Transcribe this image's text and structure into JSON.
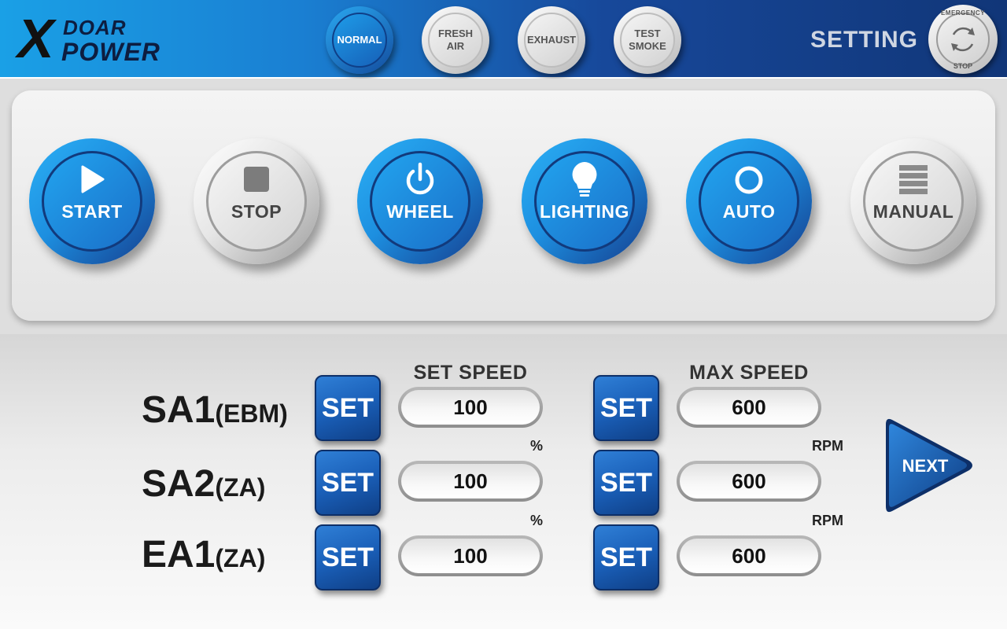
{
  "brand": {
    "line1": "DOAR",
    "line2": "POWER",
    "mark": "X"
  },
  "modes": [
    {
      "label": "NORMAL",
      "active": true
    },
    {
      "label": "FRESH AIR",
      "active": false
    },
    {
      "label": "EXHAUST",
      "active": false
    },
    {
      "label": "TEST SMOKE",
      "active": false
    }
  ],
  "header": {
    "setting_label": "SETTING"
  },
  "estop": {
    "top_text": "EMERGENCY",
    "bottom_text": "STOP",
    "icon": "rotate-icon"
  },
  "controls": [
    {
      "label": "START",
      "icon": "play-icon",
      "active": true
    },
    {
      "label": "STOP",
      "icon": "stop-square-icon",
      "active": false
    },
    {
      "label": "WHEEL",
      "icon": "power-icon",
      "active": true
    },
    {
      "label": "LIGHTING",
      "icon": "bulb-icon",
      "active": true
    },
    {
      "label": "AUTO",
      "icon": "circle-icon",
      "active": true
    },
    {
      "label": "MANUAL",
      "icon": "menu-bars-icon",
      "active": false
    }
  ],
  "speed_table": {
    "set_speed_header": "SET SPEED",
    "max_speed_header": "MAX SPEED",
    "set_button_label": "SET",
    "rows": [
      {
        "name": "SA1",
        "suffix": "(EBM)",
        "set_speed": "100",
        "max_speed": "600"
      },
      {
        "name": "SA2",
        "suffix": "(ZA)",
        "set_speed": "100",
        "max_speed": "600"
      },
      {
        "name": "EA1",
        "suffix": "(ZA)",
        "set_speed": "100",
        "max_speed": "600"
      }
    ],
    "units": {
      "percent": "%",
      "rpm": "RPM"
    }
  },
  "next": {
    "label": "NEXT"
  },
  "colors": {
    "header_blue": "#1a7fd2",
    "button_blue": "#1d8fe0",
    "set_blue": "#1a5fb8",
    "grey_button": "#e6e6e6"
  }
}
